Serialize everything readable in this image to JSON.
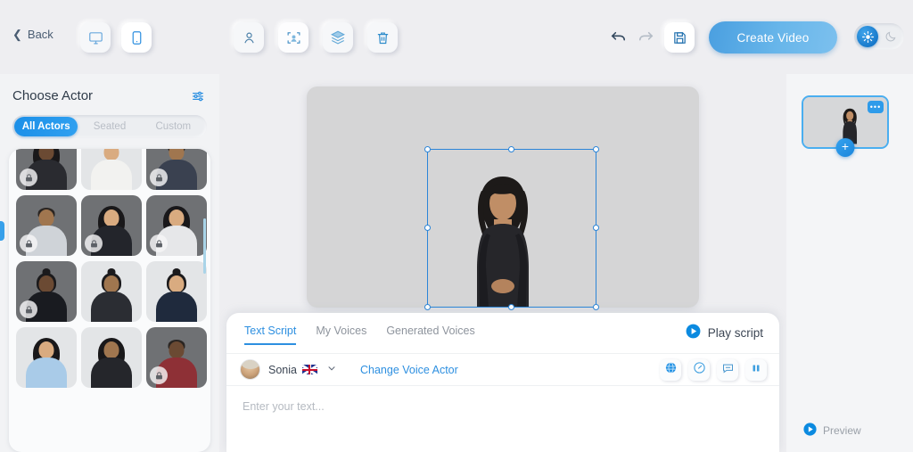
{
  "topbar": {
    "back_label": "Back",
    "back_icon": "chevron-left-icon",
    "device_desktop_icon": "desktop-icon",
    "device_mobile_icon": "mobile-icon",
    "tools": [
      {
        "name": "avatar-tool",
        "icon": "person-icon"
      },
      {
        "name": "background-tool",
        "icon": "avatar-frame-icon"
      },
      {
        "name": "layers-tool",
        "icon": "layers-icon"
      },
      {
        "name": "delete-tool",
        "icon": "trash-icon"
      }
    ],
    "undo_icon": "undo-icon",
    "redo_icon": "redo-icon",
    "save_icon": "save-icon",
    "create_video_label": "Create Video",
    "theme_light_icon": "sun-icon",
    "theme_dark_icon": "moon-icon",
    "accent_color": "#2d8fe0",
    "create_video_gradient_from": "#4a9fe0",
    "create_video_gradient_to": "#7cc0ee"
  },
  "sidebar": {
    "title": "Choose Actor",
    "filter_icon": "sliders-icon",
    "tabs": [
      {
        "label": "All Actors",
        "active": true
      },
      {
        "label": "Seated",
        "active": false
      },
      {
        "label": "Custom",
        "active": false
      }
    ],
    "actors": [
      {
        "locked": true,
        "tone": "dark",
        "hair": "long",
        "outfit": "#2a2b30"
      },
      {
        "locked": false,
        "tone": "light",
        "hair": "bald",
        "outfit": "#f2f2f0"
      },
      {
        "locked": true,
        "tone": "mid",
        "hair": "short",
        "outfit": "#3a4150"
      },
      {
        "locked": true,
        "tone": "mid",
        "hair": "short",
        "outfit": "#cfd3d8"
      },
      {
        "locked": true,
        "tone": "light",
        "hair": "long",
        "outfit": "#23252b"
      },
      {
        "locked": true,
        "tone": "light",
        "hair": "long",
        "outfit": "#e6e7e9"
      },
      {
        "locked": true,
        "tone": "dark",
        "hair": "bun",
        "outfit": "#191b20"
      },
      {
        "locked": false,
        "tone": "mid",
        "hair": "bun",
        "outfit": "#2b2d33"
      },
      {
        "locked": false,
        "tone": "light",
        "hair": "bun",
        "outfit": "#1f2a3d"
      },
      {
        "locked": false,
        "tone": "light",
        "hair": "long",
        "outfit": "#a9cbe8"
      },
      {
        "locked": false,
        "tone": "mid",
        "hair": "curly",
        "outfit": "#25262b"
      },
      {
        "locked": true,
        "tone": "dark",
        "hair": "short",
        "outfit": "#8e3036"
      }
    ],
    "scrollbar_color": "#a9d4e8",
    "collapse_handle_color": "#37a0ea"
  },
  "canvas": {
    "selected_actor_name": "canvas-actor",
    "selection_color": "#2b85d8",
    "background_color": "#d5d5d6"
  },
  "script": {
    "tabs": [
      {
        "label": "Text Script",
        "active": true
      },
      {
        "label": "My Voices",
        "active": false
      },
      {
        "label": "Generated Voices",
        "active": false
      }
    ],
    "play_script_label": "Play script",
    "play_icon": "play-circle-icon",
    "voice_name": "Sonia",
    "voice_flag": "uk-flag-icon",
    "voice_dropdown_icon": "chevron-down-icon",
    "change_voice_label": "Change Voice Actor",
    "actions": [
      {
        "name": "translate-button",
        "icon": "globe-icon",
        "active": true
      },
      {
        "name": "speed-button",
        "icon": "gauge-icon",
        "active": false
      },
      {
        "name": "pronunciation-button",
        "icon": "speech-bubble-icon",
        "active": false
      },
      {
        "name": "pause-button",
        "icon": "pause-icon",
        "active": false
      }
    ],
    "input_value": "",
    "input_placeholder": "Enter your text..."
  },
  "right_panel": {
    "scene_menu_label": "•••",
    "add_scene_label": "+",
    "preview_label": "Preview",
    "preview_icon": "play-circle-icon"
  }
}
